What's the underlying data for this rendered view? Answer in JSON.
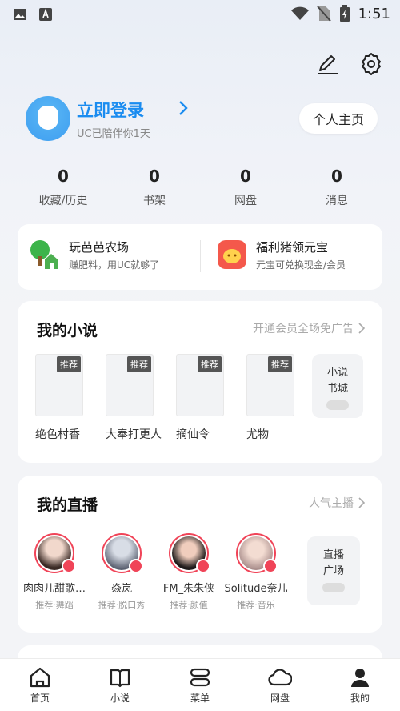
{
  "status_bar": {
    "time": "1:51"
  },
  "profile": {
    "login": "立即登录",
    "subtitle": "UC已陪伴你1天",
    "home_button": "个人主页"
  },
  "stats": [
    {
      "count": "0",
      "label": "收藏/历史"
    },
    {
      "count": "0",
      "label": "书架"
    },
    {
      "count": "0",
      "label": "网盘"
    },
    {
      "count": "0",
      "label": "消息"
    }
  ],
  "promos": [
    {
      "title": "玩芭芭农场",
      "desc": "赚肥料，用UC就够了",
      "icon": "farm-icon"
    },
    {
      "title": "福利猪领元宝",
      "desc": "元宝可兑换现金/会员",
      "icon": "piggy-icon"
    }
  ],
  "novels": {
    "title": "我的小说",
    "more": "开通会员全场免广告",
    "books": [
      {
        "name": "绝色村香",
        "tag": "推荐"
      },
      {
        "name": "大奉打更人",
        "tag": "推荐"
      },
      {
        "name": "摘仙令",
        "tag": "推荐"
      },
      {
        "name": "尤物",
        "tag": "推荐"
      }
    ],
    "store": {
      "line1": "小说",
      "line2": "书城"
    }
  },
  "live": {
    "title": "我的直播",
    "more": "人气主播",
    "streamers": [
      {
        "name": "肉肉儿甜歌…",
        "category": "推荐·舞蹈"
      },
      {
        "name": "焱岚",
        "category": "推荐·脱口秀"
      },
      {
        "name": "FM_朱朱侠",
        "category": "推荐·颜值"
      },
      {
        "name": "Solitude奈儿",
        "category": "推荐·音乐"
      }
    ],
    "plaza": {
      "line1": "直播",
      "line2": "广场"
    }
  },
  "nav": [
    {
      "label": "首页",
      "icon": "home-icon"
    },
    {
      "label": "小说",
      "icon": "book-icon"
    },
    {
      "label": "菜单",
      "icon": "menu-icon"
    },
    {
      "label": "网盘",
      "icon": "cloud-icon"
    },
    {
      "label": "我的",
      "icon": "user-icon"
    }
  ],
  "colors": {
    "accent": "#1a8cf0",
    "live_ring": "#f04458"
  }
}
